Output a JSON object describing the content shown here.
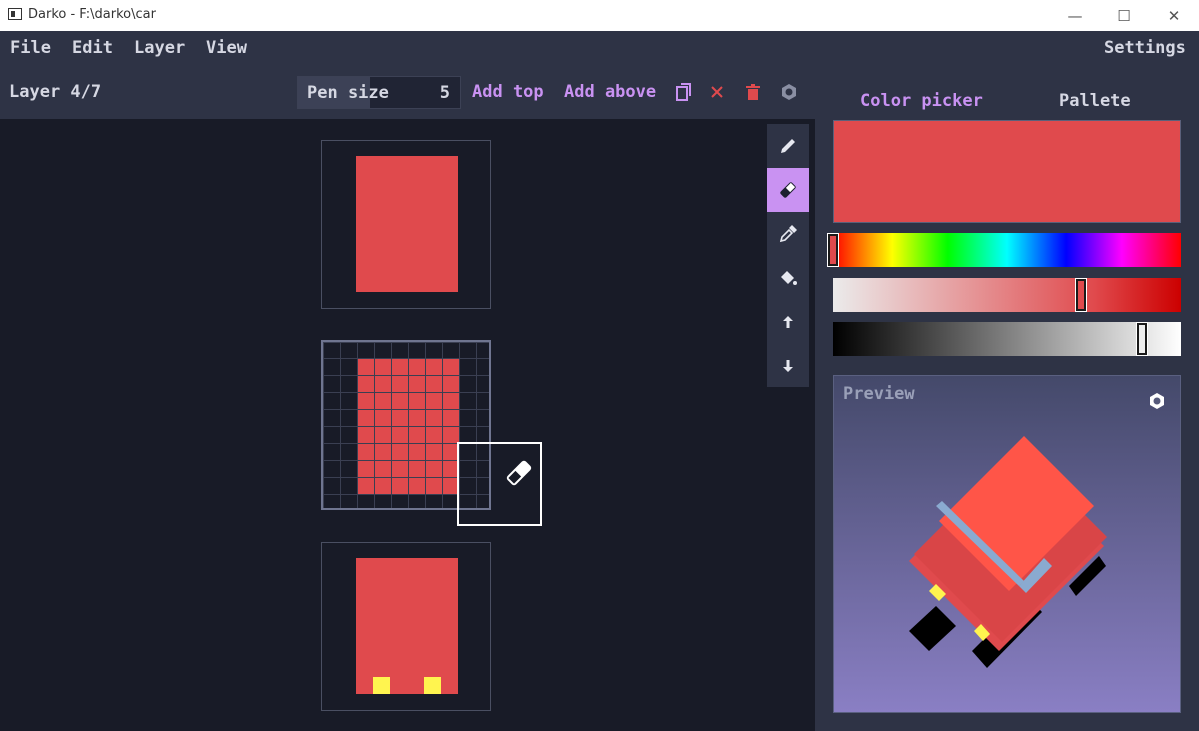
{
  "window": {
    "title": "Darko - F:\\darko\\car"
  },
  "menu": {
    "items": [
      "File",
      "Edit",
      "Layer",
      "View"
    ],
    "settings": "Settings"
  },
  "toolbar": {
    "layer_label": "Layer 4/7",
    "pen_size_label": "Pen size",
    "pen_size_value": "5",
    "add_top": "Add top",
    "add_above": "Add above",
    "icons": [
      "copy-icon",
      "close-icon",
      "trash-icon",
      "gear-icon"
    ]
  },
  "tools": {
    "items": [
      "pencil-icon",
      "eraser-icon",
      "eyedropper-icon",
      "fill-bucket-icon",
      "arrow-up-icon",
      "arrow-down-icon"
    ],
    "active": "eraser-icon"
  },
  "panel": {
    "tabs": [
      "Color picker",
      "Pallete"
    ],
    "active_tab": "Color picker",
    "current_color": "#e04a4d",
    "hue_position": 0.0,
    "saturation_position": 0.72,
    "value_position": 0.9,
    "preview_label": "Preview"
  },
  "colors": {
    "accent": "#c992f2",
    "car_red": "#e04a4d",
    "yellow": "#fff44f",
    "bg": "#181b27",
    "panel": "#2e3345"
  }
}
